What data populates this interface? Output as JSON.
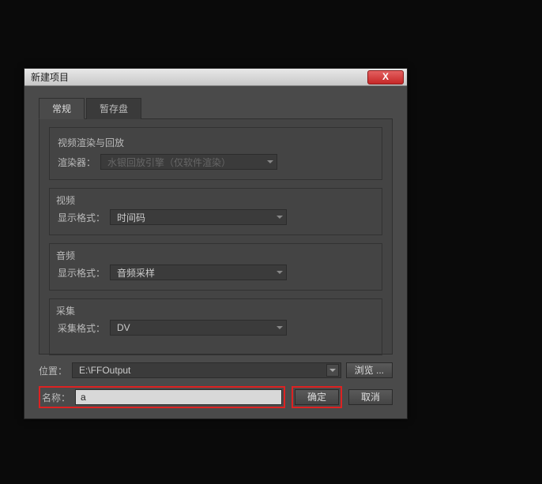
{
  "titlebar": {
    "title": "新建项目",
    "close": "X"
  },
  "tabs": {
    "general": "常规",
    "scratch": "暂存盘"
  },
  "render": {
    "section_label": "视频渲染与回放",
    "renderer_label": "渲染器：",
    "renderer_value": "水银回放引擎（仅软件渲染）"
  },
  "video": {
    "section_label": "视频",
    "format_label": "显示格式：",
    "format_value": "时间码"
  },
  "audio": {
    "section_label": "音频",
    "format_label": "显示格式：",
    "format_value": "音频采样"
  },
  "capture": {
    "section_label": "采集",
    "format_label": "采集格式：",
    "format_value": "DV"
  },
  "location": {
    "label": "位置：",
    "value": "E:\\FFOutput",
    "browse": "浏览 ..."
  },
  "name": {
    "label": "名称：",
    "value": "a"
  },
  "buttons": {
    "ok": "确定",
    "cancel": "取消"
  }
}
